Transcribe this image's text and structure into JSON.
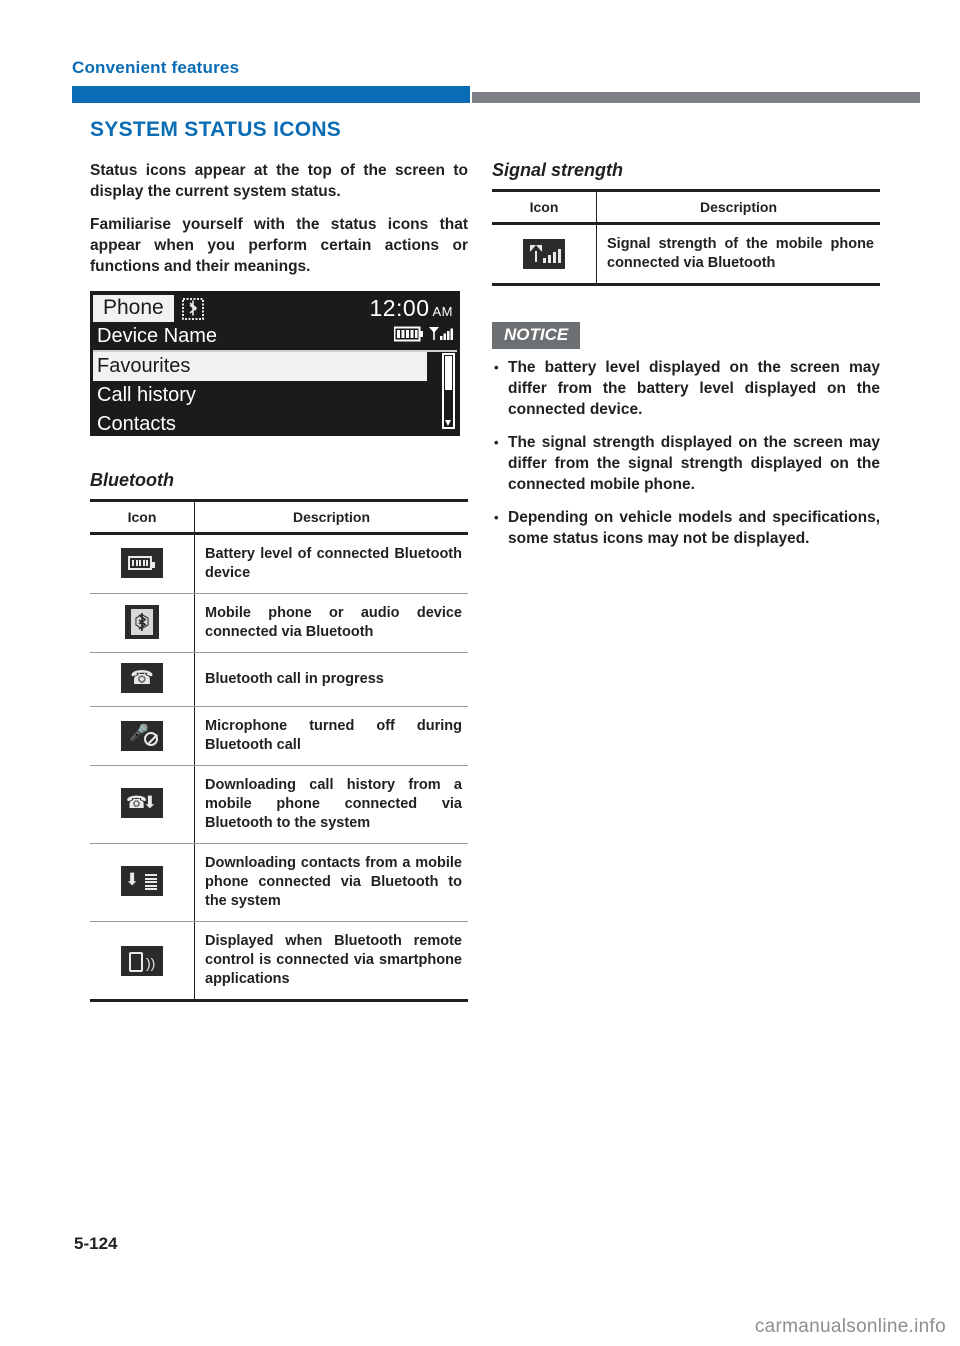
{
  "header": {
    "chapter": "Convenient features"
  },
  "left": {
    "section_title": "SYSTEM STATUS ICONS",
    "paragraphs": [
      "Status icons appear at the top of the screen to display the current system status.",
      "Familiarise yourself with the status icons that appear when you perform certain actions or functions and their meanings."
    ],
    "screen": {
      "title": "Phone",
      "bluetooth_icon": "bluetooth-icon",
      "time": "12:00",
      "ampm": "AM",
      "device_name": "Device Name",
      "status_icons": [
        "battery-icon",
        "signal-icon"
      ],
      "menu_items": [
        "Favourites",
        "Call history",
        "Contacts"
      ],
      "selected_index": 0
    },
    "bluetooth_table": {
      "heading": "Bluetooth",
      "columns": [
        "Icon",
        "Description"
      ],
      "rows": [
        {
          "icon": "battery-level-icon",
          "description": "Battery level of connected Bluetooth device"
        },
        {
          "icon": "bluetooth-connected-icon",
          "description": "Mobile phone or audio device connected via Bluetooth"
        },
        {
          "icon": "call-in-progress-icon",
          "description": "Bluetooth call in progress"
        },
        {
          "icon": "microphone-off-icon",
          "description": "Microphone turned off during Bluetooth call"
        },
        {
          "icon": "download-call-history-icon",
          "description": "Downloading call history from a mobile phone connected via Bluetooth to the system"
        },
        {
          "icon": "download-contacts-icon",
          "description": "Downloading contacts from a mobile phone connected via Bluetooth to the system"
        },
        {
          "icon": "bluetooth-remote-control-icon",
          "description": "Displayed when Bluetooth remote control is connected via smartphone applications"
        }
      ]
    }
  },
  "right": {
    "signal_table": {
      "heading": "Signal strength",
      "columns": [
        "Icon",
        "Description"
      ],
      "rows": [
        {
          "icon": "signal-strength-icon",
          "description": "Signal strength of the mobile phone connected via Bluetooth"
        }
      ]
    },
    "notice": {
      "label": "NOTICE",
      "items": [
        "The battery level displayed on the screen may differ from the battery level displayed on the connected device.",
        "The signal strength displayed on the screen may differ from the signal strength displayed on the connected mobile phone.",
        "Depending on vehicle models and specifications, some status icons may not be displayed."
      ]
    }
  },
  "footer": {
    "page_number": "5-124",
    "watermark": "carmanualsonline.info"
  },
  "colors": {
    "accent_blue": "#0a6cb4",
    "bar_gray": "#7d8084",
    "text": "#231f20",
    "notice_gray": "#6d7073"
  }
}
